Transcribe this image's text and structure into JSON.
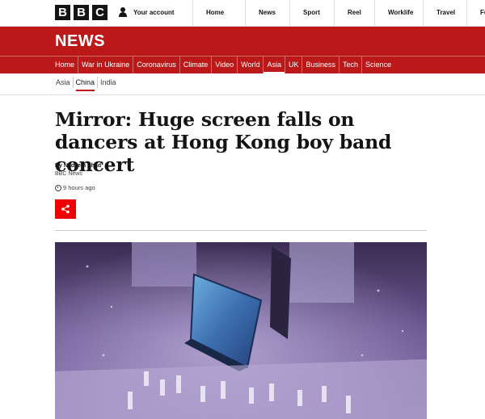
{
  "header": {
    "logo_letters": [
      "B",
      "B",
      "C"
    ],
    "account_label": "Your account",
    "account_icon": "person-icon",
    "nav": [
      "Home",
      "News",
      "Sport",
      "Reel",
      "Worklife",
      "Travel",
      "Futu"
    ]
  },
  "news_banner": {
    "title": "NEWS",
    "color": "#bb1919"
  },
  "section_nav": {
    "items": [
      "Home",
      "War in Ukraine",
      "Coronavirus",
      "Climate",
      "Video",
      "World",
      "Asia",
      "UK",
      "Business",
      "Tech",
      "Science"
    ],
    "active": "Asia"
  },
  "sub_nav": {
    "items": [
      "Asia",
      "China",
      "India"
    ],
    "active": "China"
  },
  "article": {
    "headline": "Mirror: Huge screen falls on dancers at Hong Kong boy band concert",
    "author": "By Nadeem Shad",
    "organization": "BBC News",
    "timestamp": "9 hours ago",
    "share_icon": "share-icon",
    "share_color": "#ee0000"
  }
}
